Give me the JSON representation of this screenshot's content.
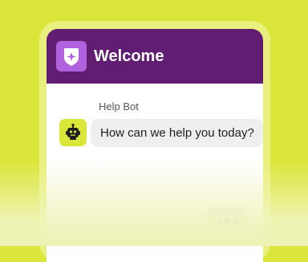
{
  "header": {
    "title": "Welcome",
    "logo_icon": "sparkle-shield-icon"
  },
  "bot": {
    "name": "Help Bot",
    "avatar_icon": "robot-icon"
  },
  "messages": [
    {
      "text": "How can we help you today?"
    }
  ],
  "typing_indicator": {
    "dots": 3
  },
  "colors": {
    "background": "#dbe63a",
    "header": "#611d72",
    "logo_badge": "#b061de",
    "avatar": "#d9e63a",
    "bubble": "#efefef"
  }
}
